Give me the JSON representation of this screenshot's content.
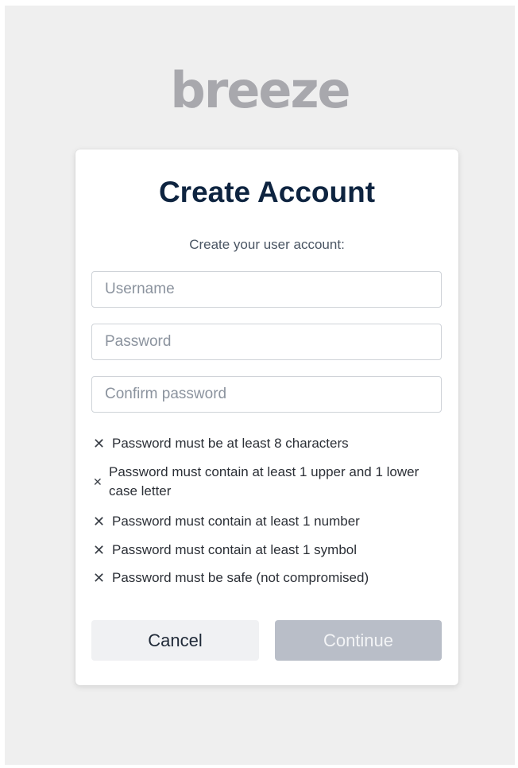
{
  "brand": {
    "logo_text": "breeze",
    "logo_color": "#a8a8ad"
  },
  "form": {
    "title": "Create Account",
    "subtitle": "Create your user account:",
    "username_placeholder": "Username",
    "username_value": "",
    "password_placeholder": "Password",
    "password_value": "",
    "confirm_placeholder": "Confirm password",
    "confirm_value": ""
  },
  "requirements": [
    {
      "icon": "x-icon",
      "symbol": "✕",
      "text": "Password must be at least 8 characters",
      "met": false
    },
    {
      "icon": "x-icon",
      "symbol": "✕",
      "text": "Password must contain at least 1 upper and 1 lower case letter",
      "met": false
    },
    {
      "icon": "x-icon",
      "symbol": "✕",
      "text": "Password must contain at least 1 number",
      "met": false
    },
    {
      "icon": "x-icon",
      "symbol": "✕",
      "text": "Password must contain at least 1 symbol",
      "met": false
    },
    {
      "icon": "x-icon",
      "symbol": "✕",
      "text": "Password must be safe (not compromised)",
      "met": false
    }
  ],
  "actions": {
    "cancel_label": "Cancel",
    "continue_label": "Continue",
    "continue_enabled": false
  },
  "colors": {
    "title": "#0e2440",
    "continue_disabled_bg": "#b9bec8",
    "cancel_bg": "#f0f1f3",
    "page_bg": "#efefef"
  }
}
